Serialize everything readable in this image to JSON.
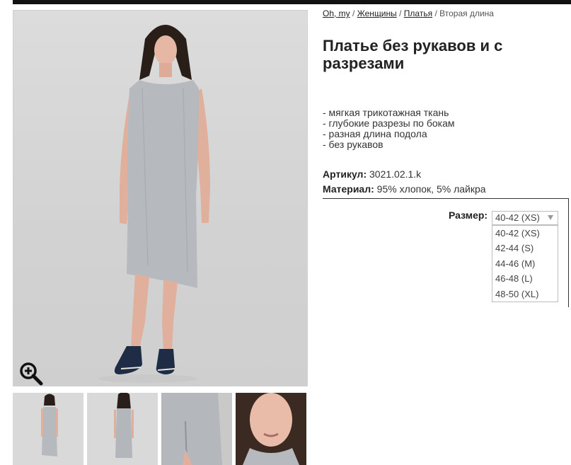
{
  "breadcrumb": {
    "items": [
      "Oh, my",
      "Женщины",
      "Платья"
    ],
    "current": "Вторая длина",
    "separator": "/"
  },
  "product": {
    "title": "Платье без рукавов и с разрезами",
    "features": [
      "- мягкая трикотажная ткань",
      "- глубокие разрезы по бокам",
      "- разная длина подола",
      "- без рукавов"
    ],
    "article_label": "Артикул:",
    "article_value": "3021.02.1.k",
    "material_label": "Материал:",
    "material_value": "95% хлопок, 5% лайкра"
  },
  "size": {
    "label": "Размер:",
    "selected": "40-42 (XS)",
    "options": [
      "40-42 (XS)",
      "42-44 (S)",
      "44-46 (M)",
      "46-48 (L)",
      "48-50 (XL)"
    ]
  },
  "icons": {
    "zoom": "zoom-in-icon",
    "select_arrow": "triangle-down-icon"
  },
  "colors": {
    "dress": "#b6b9bd",
    "skin": "#e6b7a4",
    "hair": "#2a1e18",
    "shoes": "#1e2c45",
    "background": "#d6d6d6"
  }
}
